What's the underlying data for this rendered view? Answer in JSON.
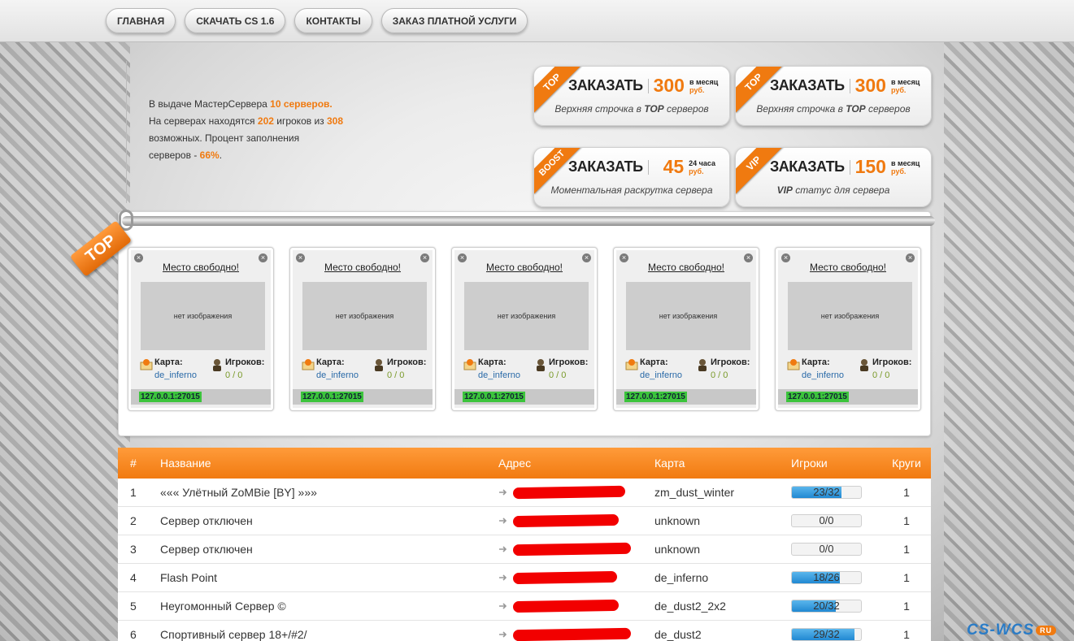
{
  "nav": [
    {
      "label": "ГЛАВНАЯ"
    },
    {
      "label": "СКАЧАТЬ CS 1.6"
    },
    {
      "label": "КОНТАКТЫ"
    },
    {
      "label": "ЗАКАЗ ПЛАТНОЙ УСЛУГИ"
    }
  ],
  "stats": {
    "p1": "В выдаче МастерСервера ",
    "servers": "10 серверов.",
    "p2": "На серверах находятся ",
    "players": "202",
    "p3": " игроков из ",
    "max": "308",
    "p4": " возможных. Процент заполнения серверов - ",
    "percent": "66%",
    "p5": "."
  },
  "orders": [
    {
      "ribbon": "TOP",
      "word": "ЗАКАЗАТЬ",
      "price": "300",
      "unit_top": "в месяц",
      "unit_bot": "руб.",
      "desc_a": "Верхняя строчка в ",
      "desc_b": "TOP",
      "desc_c": " серверов"
    },
    {
      "ribbon": "TOP",
      "word": "ЗАКАЗАТЬ",
      "price": "300",
      "unit_top": "в месяц",
      "unit_bot": "руб.",
      "desc_a": "Верхняя строчка в ",
      "desc_b": "TOP",
      "desc_c": " серверов"
    },
    {
      "ribbon": "BOOST",
      "word": "ЗАКАЗАТЬ",
      "price": "45",
      "unit_top": "24 часа",
      "unit_bot": "руб.",
      "desc_a": "Моментальная раскрутка сервера",
      "desc_b": "",
      "desc_c": ""
    },
    {
      "ribbon": "VIP",
      "word": "ЗАКАЗАТЬ",
      "price": "150",
      "unit_top": "в месяц",
      "unit_bot": "руб.",
      "desc_a": "",
      "desc_b": "VIP",
      "desc_c": " статус для сервера"
    }
  ],
  "top_tag": "TOP",
  "top_cards": [
    {
      "title": "Место свободно!",
      "noimg": "нет изображения",
      "map_label": "Карта:",
      "map": "de_inferno",
      "pl_label": "Игроков:",
      "players": "0 / 0",
      "ip": "127.0.0.1:27015"
    },
    {
      "title": "Место свободно!",
      "noimg": "нет изображения",
      "map_label": "Карта:",
      "map": "de_inferno",
      "pl_label": "Игроков:",
      "players": "0 / 0",
      "ip": "127.0.0.1:27015"
    },
    {
      "title": "Место свободно!",
      "noimg": "нет изображения",
      "map_label": "Карта:",
      "map": "de_inferno",
      "pl_label": "Игроков:",
      "players": "0 / 0",
      "ip": "127.0.0.1:27015"
    },
    {
      "title": "Место свободно!",
      "noimg": "нет изображения",
      "map_label": "Карта:",
      "map": "de_inferno",
      "pl_label": "Игроков:",
      "players": "0 / 0",
      "ip": "127.0.0.1:27015"
    },
    {
      "title": "Место свободно!",
      "noimg": "нет изображения",
      "map_label": "Карта:",
      "map": "de_inferno",
      "pl_label": "Игроков:",
      "players": "0 / 0",
      "ip": "127.0.0.1:27015"
    }
  ],
  "table": {
    "headers": {
      "num": "#",
      "name": "Название",
      "addr": "Адрес",
      "map": "Карта",
      "players": "Игроки",
      "rounds": "Круги"
    },
    "rows": [
      {
        "num": "1",
        "name": "««« Улётный ZoMBie [BY] »»»",
        "map": "zm_dust_winter",
        "players": "23/32",
        "fill": 0.72,
        "rounds": "1"
      },
      {
        "num": "2",
        "name": "Сервер отключен",
        "map": "unknown",
        "players": "0/0",
        "fill": 0,
        "rounds": "1"
      },
      {
        "num": "3",
        "name": "Сервер отключен",
        "map": "unknown",
        "players": "0/0",
        "fill": 0,
        "rounds": "1"
      },
      {
        "num": "4",
        "name": "Flash Point",
        "map": "de_inferno",
        "players": "18/26",
        "fill": 0.69,
        "rounds": "1"
      },
      {
        "num": "5",
        "name": "Неугомонный Сервер ©",
        "map": "de_dust2_2x2",
        "players": "20/32",
        "fill": 0.63,
        "rounds": "1"
      },
      {
        "num": "6",
        "name": "Спортивный сервер 18+/#2/",
        "map": "de_dust2",
        "players": "29/32",
        "fill": 0.9,
        "rounds": "1"
      }
    ]
  },
  "watermark": {
    "text": "CS-WCS",
    "ru": "RU"
  },
  "colors": {
    "accent": "#f07a10",
    "ip_green": "#3cc43c",
    "bar_blue": "#2188d2",
    "redaction": "#f20000"
  }
}
